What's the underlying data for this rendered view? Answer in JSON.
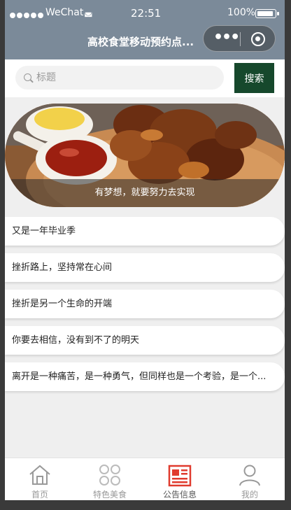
{
  "status_bar": {
    "carrier": "WeChat",
    "time": "22:51",
    "battery": "100%"
  },
  "nav": {
    "title": "高校食堂移动预约点..."
  },
  "search": {
    "placeholder": "标题",
    "button_label": "搜索"
  },
  "banner": {
    "caption": "有梦想，就要努力去实现"
  },
  "announcements": [
    "又是一年毕业季",
    "挫折路上，坚持常在心间",
    "挫折是另一个生命的开端",
    "你要去相信，没有到不了的明天",
    "离开是一种痛苦，是一种勇气，但同样也是一个考验，是一个..."
  ],
  "tabbar": {
    "items": [
      {
        "label": "首页",
        "icon": "home-icon"
      },
      {
        "label": "特色美食",
        "icon": "grid-icon"
      },
      {
        "label": "公告信息",
        "icon": "news-icon",
        "active": true
      },
      {
        "label": "我的",
        "icon": "user-icon"
      }
    ]
  },
  "colors": {
    "nav_bg": "#7b8a99",
    "search_button": "#16482c",
    "active_tab": "#e03b2e"
  }
}
